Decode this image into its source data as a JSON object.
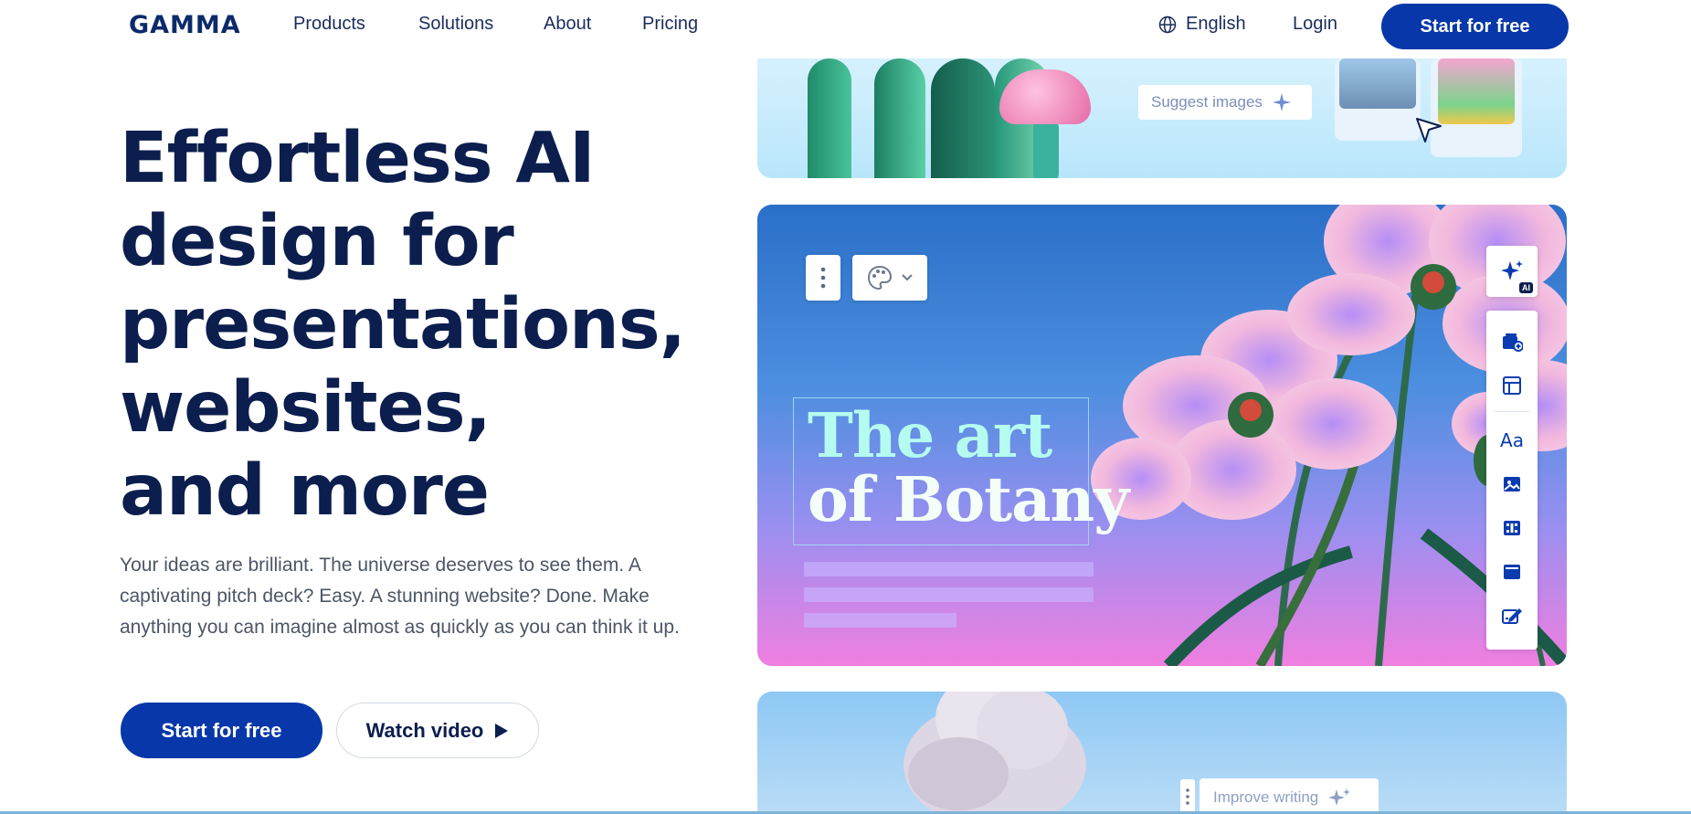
{
  "nav": {
    "logo": "GAMMA",
    "links": [
      "Products",
      "Solutions",
      "About",
      "Pricing"
    ],
    "language": "English",
    "login": "Login",
    "cta": "Start for free"
  },
  "hero": {
    "headline_lines": [
      "Effortless AI",
      "design for",
      "presentations,",
      "websites,",
      "and more"
    ],
    "subtext": "Your ideas are brilliant. The universe deserves to see them. A captivating pitch deck? Easy. A stunning website? Done. Make anything you can imagine almost as quickly as you can think it up.",
    "cta_primary": "Start for free",
    "cta_secondary": "Watch video"
  },
  "preview": {
    "suggest_images": "Suggest images",
    "slide_title_line1": "The art",
    "slide_title_line2": "of Botany",
    "ai_badge": "AI",
    "improve_writing": "Improve writing",
    "side_tool_icons": [
      "add-card-icon",
      "layout-icon",
      "text-style-icon",
      "image-icon",
      "video-icon",
      "embed-icon",
      "edit-icon"
    ]
  },
  "colors": {
    "primary": "#0737a8",
    "headline": "#0b1e4e",
    "slide_gradient_top": "#2a6fc8",
    "slide_gradient_bottom": "#f07fe0"
  }
}
